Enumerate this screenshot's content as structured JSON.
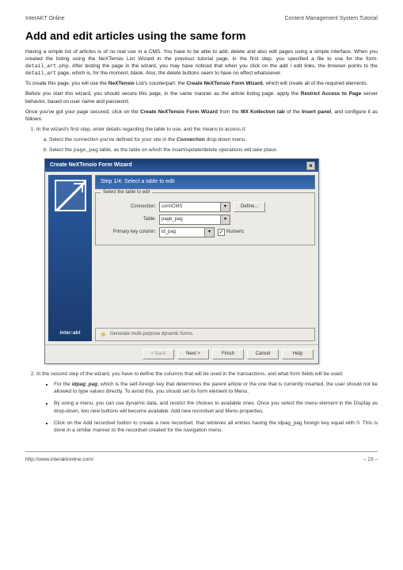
{
  "header": {
    "left": "InterAKT Online",
    "right": "Content Management System Tutorial"
  },
  "title": "Add and edit articles using the same form",
  "p1_a": "Having a simple list of articles is of no real use in a CMS. You have to be able to add, delete  and also edit pages using a simple interface. When you created the listing using the NeXTensio List Wizard in the previous tutorial page, in the first step, you specified a file to use for the form: ",
  "p1_code1": "detail_art.php",
  "p1_b": ". After testing the page in the wizard, you may have noticed that when you click on the add / edit links, the browser points to the ",
  "p1_code2": "detail_art",
  "p1_c": " page, which is, for the moment, blank. Also, the delete buttons seem to have no effect whatsoever.",
  "p2_a": "To create this page, you will use the ",
  "p2_b1": "NeXTensio",
  "p2_b": " List's counterpart: the ",
  "p2_b2": "Create NeXTensio Form Wizard",
  "p2_c": ", which will create all of the required elements.",
  "p3_a": "Before you start this wizard, you should secure this page, in the same manner as the article listing page: apply the ",
  "p3_b1": "Restrict Access to Page",
  "p3_b": " server behavior, based on user name and password.",
  "p4_a": "Once you've got your page secured, click on the ",
  "p4_b1": "Create NeXTensio Form Wizard",
  "p4_b": " from the ",
  "p4_b2": "MX Kollection tab",
  "p4_c": " of the ",
  "p4_b3": "Insert panel",
  "p4_d": ", and configure it as follows:",
  "list1": {
    "item1": "In the wizard's first step, enter details regarding the table to use, and the means to access it:",
    "sub_a_1": "Select the connection you've defined for your site in the ",
    "sub_a_b": "Connection",
    "sub_a_2": " drop-down menu.",
    "sub_b_1": "Select the ",
    "sub_b_c": "page_pag",
    "sub_b_2": " table, as the table on which the insert/update/delete operations will take place."
  },
  "wizard": {
    "title": "Create NeXTensio Form Wizard",
    "step": "Step 1/4: Select a table to edit",
    "legend": "Select the table to edit",
    "labels": {
      "connection": "Connection:",
      "table": "Table:",
      "pk": "Primary key column:"
    },
    "values": {
      "connection": "connCMS",
      "table": "page_pag",
      "pk": "id_pag"
    },
    "define": "Define...",
    "numeric": "Numeric",
    "brand": "inter:akt",
    "gen": "Generate multi-purpose dynamic forms.",
    "buttons": {
      "back": "< Back",
      "next": "Next >",
      "finish": "Finish",
      "cancel": "Cancel",
      "help": "Help"
    }
  },
  "list2": {
    "intro": "In the second step of the wizard, you have to define the columns that will be used in the transactions, and what form fields will be used:",
    "b1_a": "For the ",
    "b1_code": "idpag_pag",
    "b1_b": ", which is the self-foreign key that determines the parent article or the one that is currently inserted, the user should not be allowed to type values directly. To avoid this, you should set its form element to Menu.",
    "b2": "By using a menu, you can use dynamic data, and restrict the choices to available ones. Once you select the menu element in the Display as drop-down, two new buttons will become available: Add new recordset and Menu properties.",
    "b3": "Click on the Add recordset button to create a new recordset, that retrieves all entries having the idpag_pag foreign key equal with 0. This is done in a similar manner to the recordset created for the navigation menu."
  },
  "footer": {
    "url": "http://www.interaktonline.com/",
    "page": "– 23 –"
  }
}
